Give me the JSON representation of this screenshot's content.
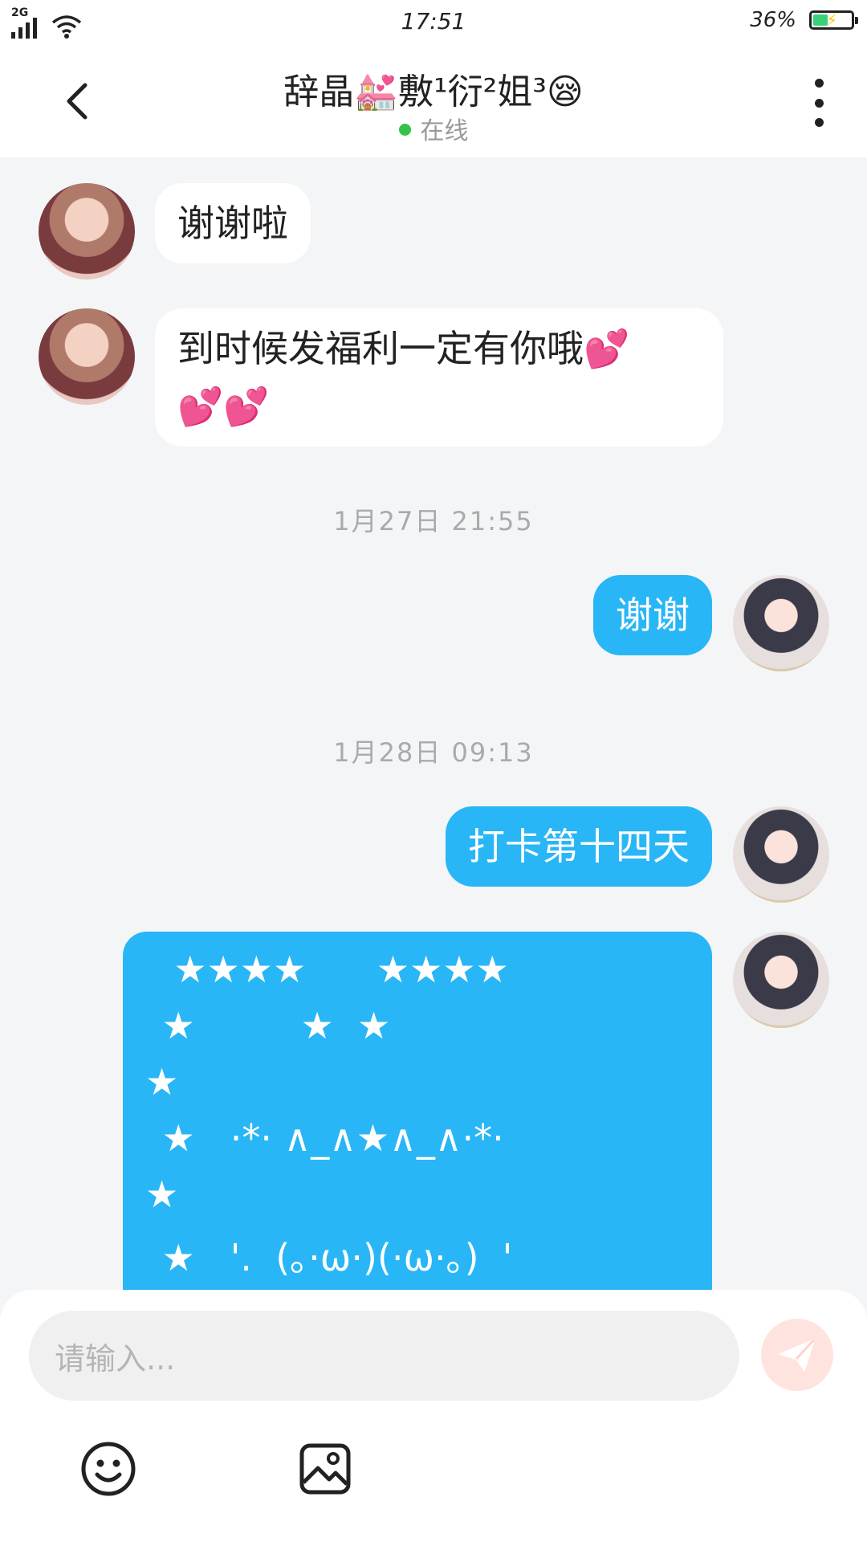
{
  "status_bar": {
    "network": "2G",
    "time": "17:51",
    "battery_text": "36%",
    "battery_level": 0.36
  },
  "header": {
    "title": "辞晶💒敷¹衍²姐³😪",
    "status": "在线"
  },
  "messages": [
    {
      "side": "in",
      "text": "谢谢啦"
    },
    {
      "side": "in",
      "text_line1": "到时候发福利一定有你哦💕",
      "text_line2": "💕💕"
    },
    {
      "timestamp": "1月27日 21:55"
    },
    {
      "side": "out",
      "text": "谢谢"
    },
    {
      "timestamp": "1月28日 09:13"
    },
    {
      "side": "out",
      "text": "打卡第十四天"
    },
    {
      "side": "out",
      "art_lines": [
        "  ★★★★      ★★★★",
        " ★         ★  ★",
        "★",
        " ★   ·*· ∧_∧★∧_∧·*·",
        "★",
        " ★   '.  (｡·ω·)(·ω·｡)  '"
      ]
    }
  ],
  "input": {
    "placeholder": "请输入..."
  },
  "colors": {
    "outgoing_bubble": "#29b6f6",
    "incoming_bubble": "#ffffff",
    "online_dot": "#36c24a",
    "send_button": "#ffe3df"
  },
  "icons": [
    "back-arrow-icon",
    "more-vertical-icon",
    "send-icon",
    "emoji-icon",
    "image-icon"
  ]
}
